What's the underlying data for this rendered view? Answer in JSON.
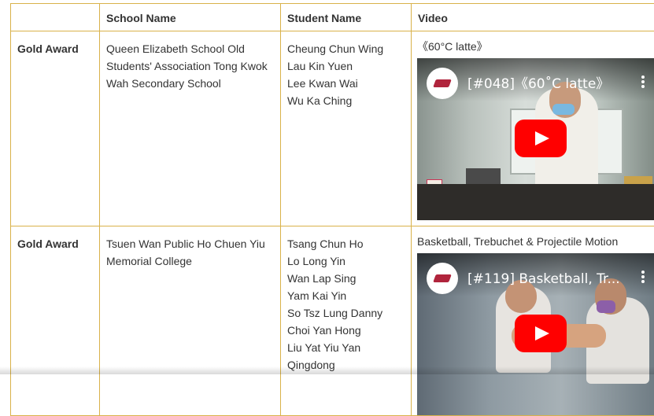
{
  "table": {
    "headers": [
      "",
      "School Name",
      "Student Name",
      "Video"
    ],
    "rows": [
      {
        "award": "Gold Award",
        "school": "Queen Elizabeth School Old Students' Association Tong Kwok Wah Secondary School",
        "students": [
          "Cheung Chun Wing",
          "Lau Kin Yuen",
          "Lee Kwan Wai",
          "Wu Ka Ching"
        ],
        "video_title": "《60°C latte》",
        "player_title": "[#048]《60˚C latte》"
      },
      {
        "award": "Gold Award",
        "school": "Tsuen Wan Public Ho Chuen Yiu Memorial College",
        "students": [
          "Tsang Chun Ho",
          "Lo Long Yin",
          "Wan Lap Sing",
          "Yam Kai Yin",
          "So Tsz Lung Danny",
          "Choi Yan Hong",
          "Liu Yat Yiu Yan",
          "Qingdong"
        ],
        "video_title": "Basketball, Trebuchet & Projectile Motion",
        "player_title": "[#119] Basketball, Tr..."
      }
    ]
  },
  "icons": {
    "play": "youtube-play-icon",
    "more": "more-vertical-icon",
    "channel": "channel-logo-icon"
  },
  "colors": {
    "border": "#d9b24a",
    "play_button": "#ff0000"
  }
}
